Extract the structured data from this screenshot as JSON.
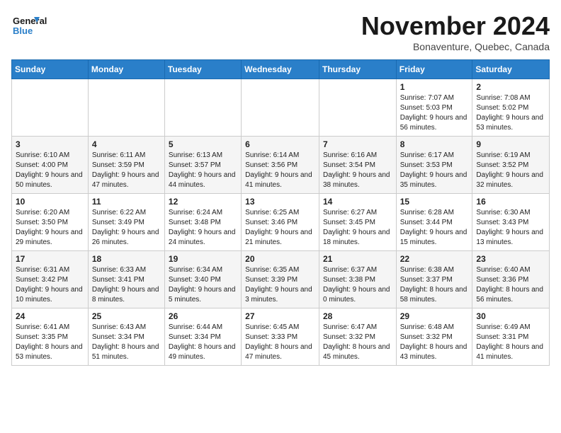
{
  "header": {
    "logo_line1": "General",
    "logo_line2": "Blue",
    "month_title": "November 2024",
    "location": "Bonaventure, Quebec, Canada"
  },
  "weekdays": [
    "Sunday",
    "Monday",
    "Tuesday",
    "Wednesday",
    "Thursday",
    "Friday",
    "Saturday"
  ],
  "weeks": [
    [
      {
        "day": "",
        "detail": ""
      },
      {
        "day": "",
        "detail": ""
      },
      {
        "day": "",
        "detail": ""
      },
      {
        "day": "",
        "detail": ""
      },
      {
        "day": "",
        "detail": ""
      },
      {
        "day": "1",
        "detail": "Sunrise: 7:07 AM\nSunset: 5:03 PM\nDaylight: 9 hours and 56 minutes."
      },
      {
        "day": "2",
        "detail": "Sunrise: 7:08 AM\nSunset: 5:02 PM\nDaylight: 9 hours and 53 minutes."
      }
    ],
    [
      {
        "day": "3",
        "detail": "Sunrise: 6:10 AM\nSunset: 4:00 PM\nDaylight: 9 hours and 50 minutes."
      },
      {
        "day": "4",
        "detail": "Sunrise: 6:11 AM\nSunset: 3:59 PM\nDaylight: 9 hours and 47 minutes."
      },
      {
        "day": "5",
        "detail": "Sunrise: 6:13 AM\nSunset: 3:57 PM\nDaylight: 9 hours and 44 minutes."
      },
      {
        "day": "6",
        "detail": "Sunrise: 6:14 AM\nSunset: 3:56 PM\nDaylight: 9 hours and 41 minutes."
      },
      {
        "day": "7",
        "detail": "Sunrise: 6:16 AM\nSunset: 3:54 PM\nDaylight: 9 hours and 38 minutes."
      },
      {
        "day": "8",
        "detail": "Sunrise: 6:17 AM\nSunset: 3:53 PM\nDaylight: 9 hours and 35 minutes."
      },
      {
        "day": "9",
        "detail": "Sunrise: 6:19 AM\nSunset: 3:52 PM\nDaylight: 9 hours and 32 minutes."
      }
    ],
    [
      {
        "day": "10",
        "detail": "Sunrise: 6:20 AM\nSunset: 3:50 PM\nDaylight: 9 hours and 29 minutes."
      },
      {
        "day": "11",
        "detail": "Sunrise: 6:22 AM\nSunset: 3:49 PM\nDaylight: 9 hours and 26 minutes."
      },
      {
        "day": "12",
        "detail": "Sunrise: 6:24 AM\nSunset: 3:48 PM\nDaylight: 9 hours and 24 minutes."
      },
      {
        "day": "13",
        "detail": "Sunrise: 6:25 AM\nSunset: 3:46 PM\nDaylight: 9 hours and 21 minutes."
      },
      {
        "day": "14",
        "detail": "Sunrise: 6:27 AM\nSunset: 3:45 PM\nDaylight: 9 hours and 18 minutes."
      },
      {
        "day": "15",
        "detail": "Sunrise: 6:28 AM\nSunset: 3:44 PM\nDaylight: 9 hours and 15 minutes."
      },
      {
        "day": "16",
        "detail": "Sunrise: 6:30 AM\nSunset: 3:43 PM\nDaylight: 9 hours and 13 minutes."
      }
    ],
    [
      {
        "day": "17",
        "detail": "Sunrise: 6:31 AM\nSunset: 3:42 PM\nDaylight: 9 hours and 10 minutes."
      },
      {
        "day": "18",
        "detail": "Sunrise: 6:33 AM\nSunset: 3:41 PM\nDaylight: 9 hours and 8 minutes."
      },
      {
        "day": "19",
        "detail": "Sunrise: 6:34 AM\nSunset: 3:40 PM\nDaylight: 9 hours and 5 minutes."
      },
      {
        "day": "20",
        "detail": "Sunrise: 6:35 AM\nSunset: 3:39 PM\nDaylight: 9 hours and 3 minutes."
      },
      {
        "day": "21",
        "detail": "Sunrise: 6:37 AM\nSunset: 3:38 PM\nDaylight: 9 hours and 0 minutes."
      },
      {
        "day": "22",
        "detail": "Sunrise: 6:38 AM\nSunset: 3:37 PM\nDaylight: 8 hours and 58 minutes."
      },
      {
        "day": "23",
        "detail": "Sunrise: 6:40 AM\nSunset: 3:36 PM\nDaylight: 8 hours and 56 minutes."
      }
    ],
    [
      {
        "day": "24",
        "detail": "Sunrise: 6:41 AM\nSunset: 3:35 PM\nDaylight: 8 hours and 53 minutes."
      },
      {
        "day": "25",
        "detail": "Sunrise: 6:43 AM\nSunset: 3:34 PM\nDaylight: 8 hours and 51 minutes."
      },
      {
        "day": "26",
        "detail": "Sunrise: 6:44 AM\nSunset: 3:34 PM\nDaylight: 8 hours and 49 minutes."
      },
      {
        "day": "27",
        "detail": "Sunrise: 6:45 AM\nSunset: 3:33 PM\nDaylight: 8 hours and 47 minutes."
      },
      {
        "day": "28",
        "detail": "Sunrise: 6:47 AM\nSunset: 3:32 PM\nDaylight: 8 hours and 45 minutes."
      },
      {
        "day": "29",
        "detail": "Sunrise: 6:48 AM\nSunset: 3:32 PM\nDaylight: 8 hours and 43 minutes."
      },
      {
        "day": "30",
        "detail": "Sunrise: 6:49 AM\nSunset: 3:31 PM\nDaylight: 8 hours and 41 minutes."
      }
    ]
  ]
}
